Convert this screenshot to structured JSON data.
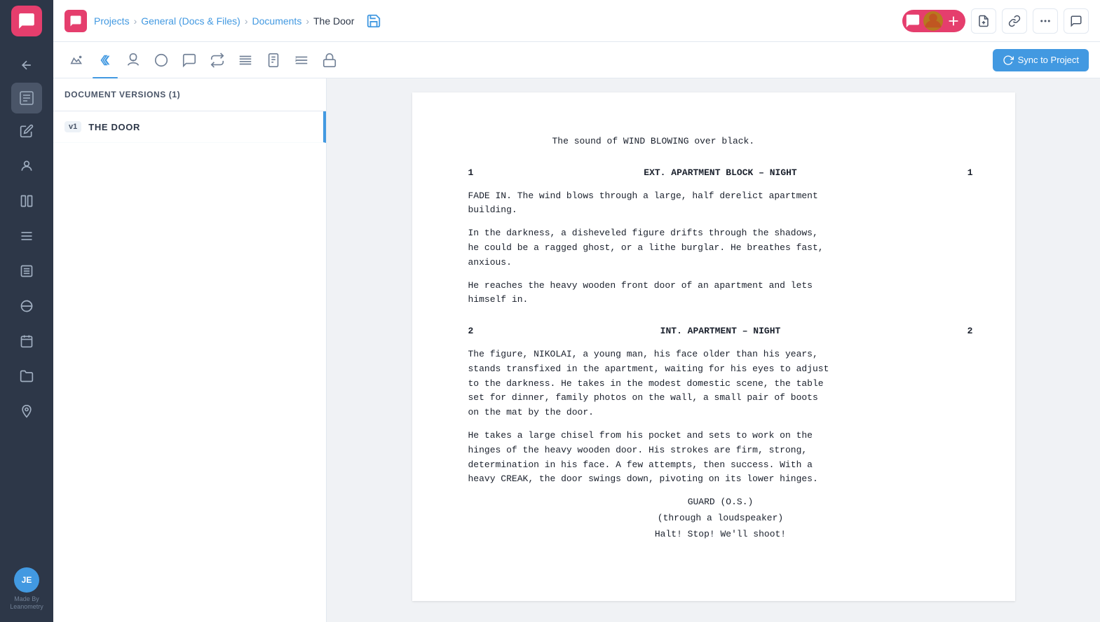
{
  "app": {
    "logo_label": "Chat App",
    "made_by": "Made By\nLeanometry"
  },
  "nav": {
    "items": [
      {
        "name": "back",
        "label": "Back"
      },
      {
        "name": "edit",
        "label": "Edit"
      },
      {
        "name": "character",
        "label": "Character"
      },
      {
        "name": "boards",
        "label": "Boards"
      },
      {
        "name": "schedule",
        "label": "Schedule"
      },
      {
        "name": "list",
        "label": "List"
      },
      {
        "name": "sports",
        "label": "Sports"
      },
      {
        "name": "calendar",
        "label": "Calendar"
      },
      {
        "name": "folder",
        "label": "Folder"
      },
      {
        "name": "location",
        "label": "Location"
      }
    ],
    "user_initials": "JE"
  },
  "header": {
    "breadcrumb": {
      "projects": "Projects",
      "general": "General (Docs & Files)",
      "documents": "Documents",
      "current": "The Door"
    },
    "save_icon": "💾"
  },
  "toolbar": {
    "icons": [
      {
        "name": "mountain",
        "label": "Scene"
      },
      {
        "name": "megaphone",
        "label": "Script",
        "active": true
      },
      {
        "name": "mask",
        "label": "Character"
      },
      {
        "name": "circle",
        "label": "Beat"
      },
      {
        "name": "comment",
        "label": "Comment"
      },
      {
        "name": "arrows",
        "label": "Flow"
      },
      {
        "name": "lines",
        "label": "Format"
      },
      {
        "name": "document",
        "label": "Document"
      },
      {
        "name": "numbering",
        "label": "Numbering"
      },
      {
        "name": "lock",
        "label": "Lock"
      }
    ],
    "sync_button": "Sync to Project"
  },
  "sidebar": {
    "header": "DOCUMENT VERSIONS (1)",
    "versions": [
      {
        "badge": "v1",
        "title": "THE DOOR"
      }
    ]
  },
  "script": {
    "intro": "The sound of WIND BLOWING over black.",
    "scenes": [
      {
        "number": "1",
        "heading": "EXT. APARTMENT BLOCK – NIGHT",
        "action": [
          "FADE IN. The wind blows through a large, half derelict apartment\nbuilding.",
          "In the darkness, a disheveled figure drifts through the shadows,\nhe could be a ragged ghost, or a lithe burglar. He breathes fast,\nanxious.",
          "He reaches the heavy wooden front door of an apartment and lets\nhimself in."
        ]
      },
      {
        "number": "2",
        "heading": "INT. APARTMENT – NIGHT",
        "action": [
          "The figure, NIKOLAI, a young man, his face older than his years,\nstands transfixed in the apartment, waiting for his eyes to adjust\nto the darkness. He takes in the modest domestic scene, the table\nset for dinner, family photos on the wall, a small pair of boots\non the mat by the door.",
          "He takes a large chisel from his pocket and sets to work on the\nhinges of the heavy wooden door. His strokes are firm, strong,\ndetermination in his face. A few attempts, then success. With a\nheavy CREAK, the door swings down, pivoting on its lower hinges."
        ],
        "dialogue": [
          {
            "character": "GUARD (O.S.)",
            "parenthetical": "(through a loudspeaker)",
            "line": "Halt! Stop! We'll shoot!"
          }
        ]
      }
    ]
  }
}
